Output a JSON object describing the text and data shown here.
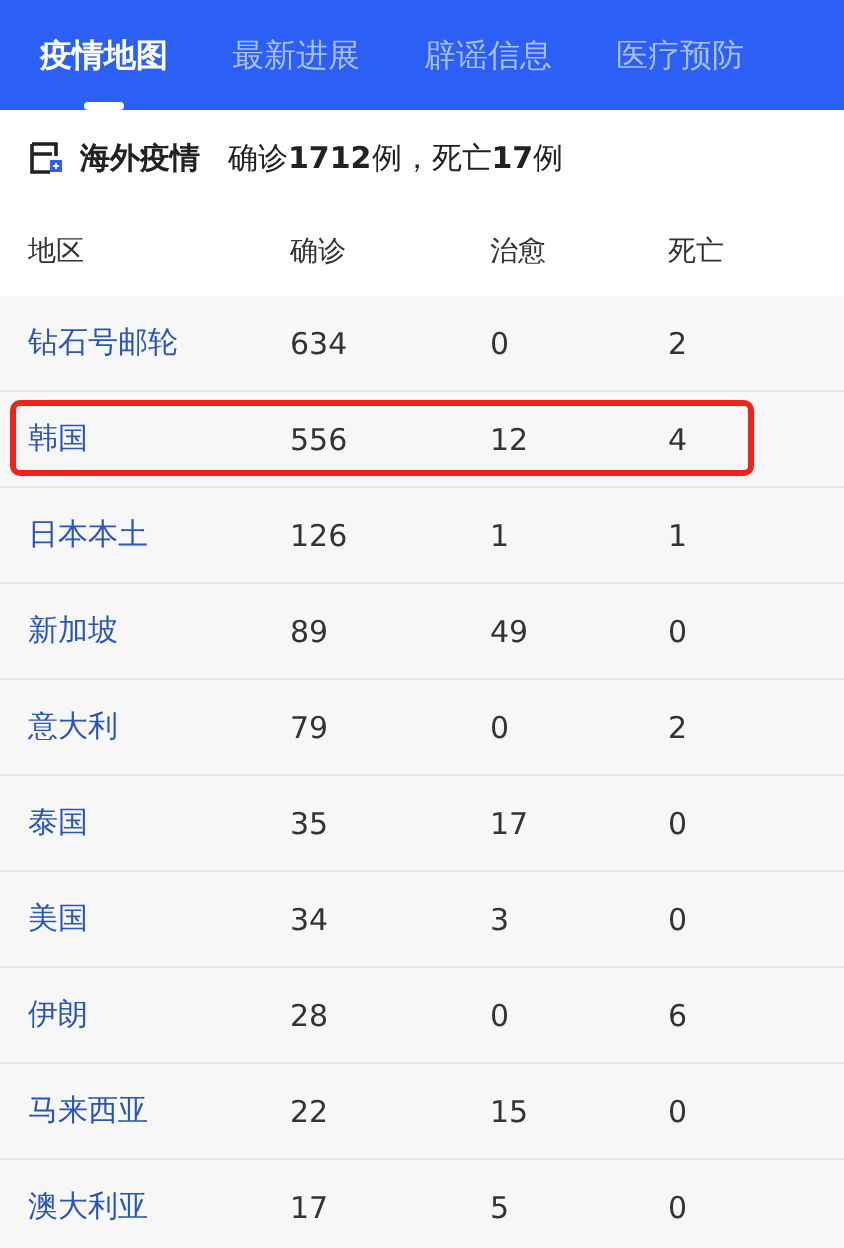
{
  "tabs": [
    {
      "label": "疫情地图",
      "selected": true
    },
    {
      "label": "最新进展",
      "selected": false
    },
    {
      "label": "辟谣信息",
      "selected": false
    },
    {
      "label": "医疗预防",
      "selected": false
    }
  ],
  "summary": {
    "title": "海外疫情",
    "text": "确诊**1712**例，死亡**17**例"
  },
  "table": {
    "columns": [
      "地区",
      "确诊",
      "治愈",
      "死亡"
    ],
    "rows": [
      {
        "region": "钻石号邮轮",
        "confirmed": "634",
        "cured": "0",
        "dead": "2",
        "highlighted": false
      },
      {
        "region": "韩国",
        "confirmed": "556",
        "cured": "12",
        "dead": "4",
        "highlighted": true
      },
      {
        "region": "日本本土",
        "confirmed": "126",
        "cured": "1",
        "dead": "1",
        "highlighted": false
      },
      {
        "region": "新加坡",
        "confirmed": "89",
        "cured": "49",
        "dead": "0",
        "highlighted": false
      },
      {
        "region": "意大利",
        "confirmed": "79",
        "cured": "0",
        "dead": "2",
        "highlighted": false
      },
      {
        "region": "泰国",
        "confirmed": "35",
        "cured": "17",
        "dead": "0",
        "highlighted": false
      },
      {
        "region": "美国",
        "confirmed": "34",
        "cured": "3",
        "dead": "0",
        "highlighted": false
      },
      {
        "region": "伊朗",
        "confirmed": "28",
        "cured": "0",
        "dead": "6",
        "highlighted": false
      },
      {
        "region": "马来西亚",
        "confirmed": "22",
        "cured": "15",
        "dead": "0",
        "highlighted": false
      },
      {
        "region": "澳大利亚",
        "confirmed": "17",
        "cured": "5",
        "dead": "0",
        "highlighted": false
      }
    ]
  }
}
